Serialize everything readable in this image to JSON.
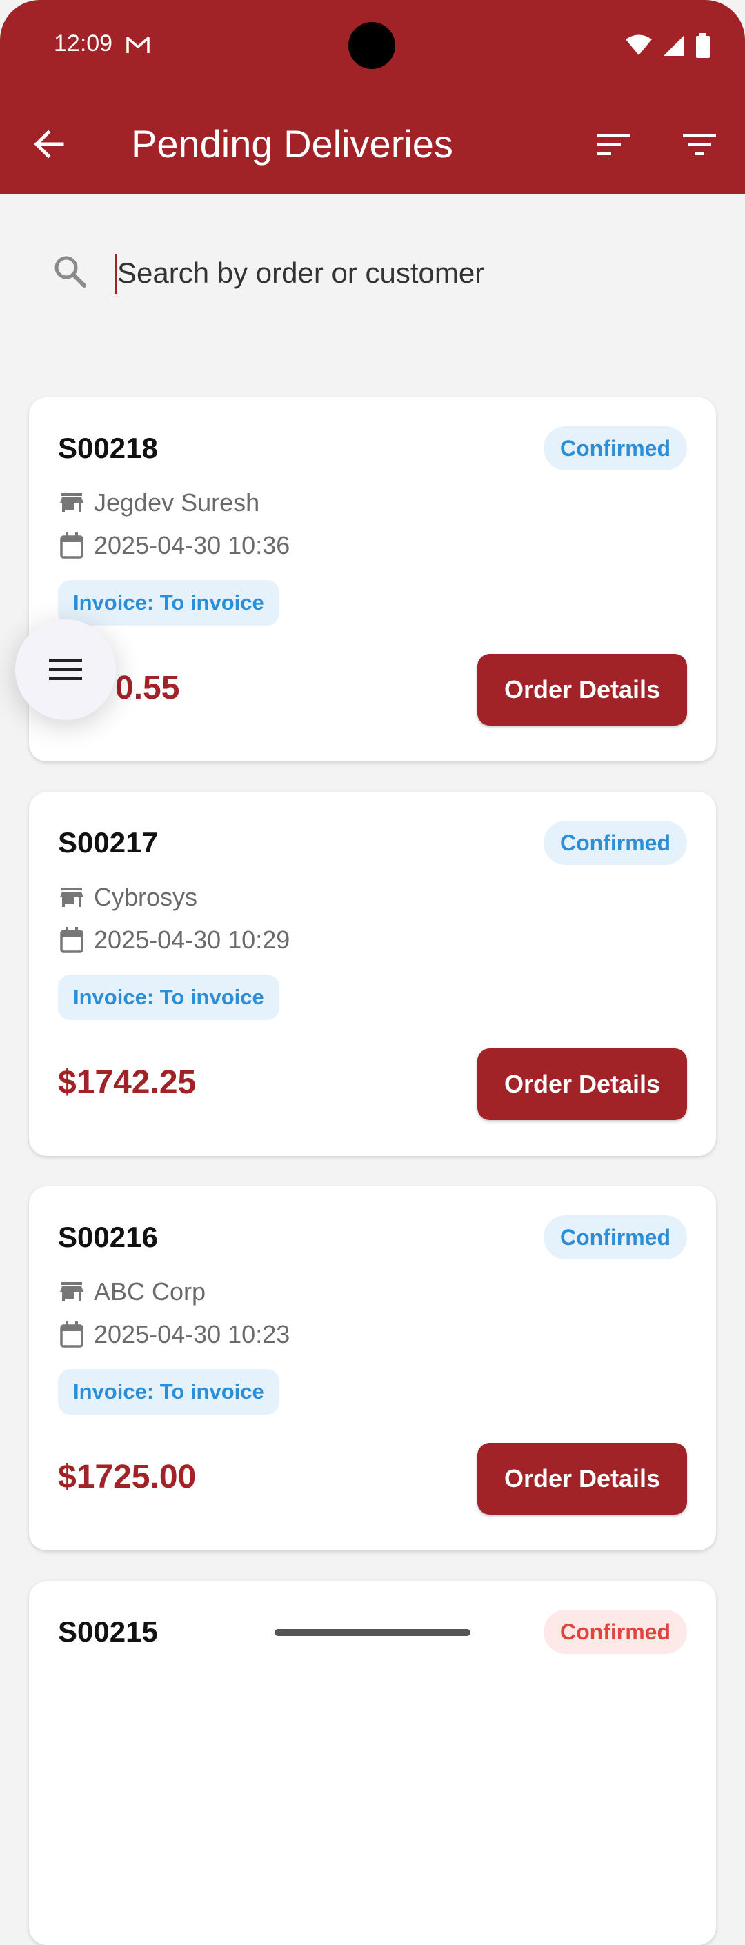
{
  "status": {
    "time": "12:09"
  },
  "appbar": {
    "title": "Pending Deliveries"
  },
  "search": {
    "placeholder": "Search by order or customer",
    "value": ""
  },
  "orders": [
    {
      "id": "S00218",
      "status": "Confirmed",
      "customer": "Jegdev Suresh",
      "datetime": "2025-04-30 10:36",
      "invoice": "Invoice: To invoice",
      "amount": "0.55",
      "button": "Order Details"
    },
    {
      "id": "S00217",
      "status": "Confirmed",
      "customer": "Cybrosys",
      "datetime": "2025-04-30 10:29",
      "invoice": "Invoice: To invoice",
      "amount": "$1742.25",
      "button": "Order Details"
    },
    {
      "id": "S00216",
      "status": "Confirmed",
      "customer": "ABC Corp",
      "datetime": "2025-04-30 10:23",
      "invoice": "Invoice: To invoice",
      "amount": "$1725.00",
      "button": "Order Details"
    },
    {
      "id": "S00215",
      "status": "Confirmed"
    }
  ],
  "colors": {
    "primary": "#a12227",
    "badge_blue_text": "#2a8fd8",
    "badge_blue_bg": "#e6f2fb",
    "badge_red_text": "#e0443c",
    "badge_red_bg": "#fde9e8",
    "background": "#f3f3f3"
  },
  "icons": [
    "mail-icon",
    "wifi-icon",
    "signal-icon",
    "battery-icon",
    "back-arrow-icon",
    "sort-icon",
    "filter-icon",
    "search-icon",
    "store-icon",
    "calendar-icon",
    "menu-icon"
  ]
}
